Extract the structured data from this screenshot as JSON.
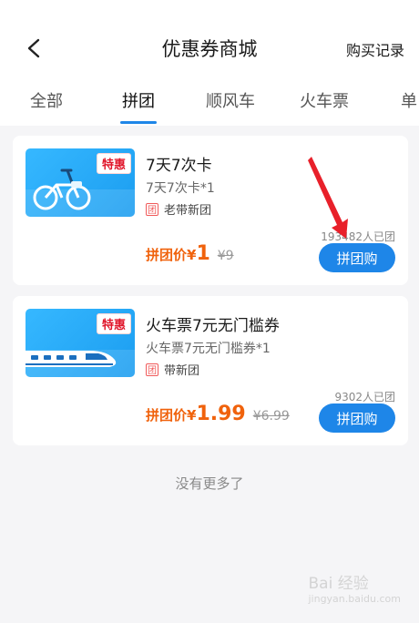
{
  "header": {
    "title": "优惠券商城",
    "records_label": "购买记录"
  },
  "tabs": [
    {
      "label": "全部"
    },
    {
      "label": "拼团"
    },
    {
      "label": "顺风车"
    },
    {
      "label": "火车票"
    },
    {
      "label": "单"
    }
  ],
  "active_tab_index": 1,
  "items": [
    {
      "name": "7天7次卡",
      "subtitle": "7天7次卡*1",
      "badge": "特惠",
      "group_tag": "团",
      "group_label": "老带新团",
      "joined": "193482人已团",
      "price_prefix": "拼团价¥",
      "price": "1",
      "original_price": "¥9",
      "button_label": "拼团购",
      "thumb_icon": "bicycle-icon"
    },
    {
      "name": "火车票7元无门槛券",
      "subtitle": "火车票7元无门槛券*1",
      "badge": "特惠",
      "group_tag": "团",
      "group_label": "带新团",
      "joined": "9302人已团",
      "price_prefix": "拼团价¥",
      "price": "1.99",
      "original_price": "¥6.99",
      "button_label": "拼团购",
      "thumb_icon": "train-icon"
    }
  ],
  "footer": {
    "no_more": "没有更多了"
  },
  "watermark": {
    "brand": "Bai 经验",
    "url": "jingyan.baidu.com"
  },
  "colors": {
    "accent": "#1e86e8",
    "price": "#f0620c",
    "badge": "#e0162b",
    "annotation_arrow": "#e8202a"
  }
}
